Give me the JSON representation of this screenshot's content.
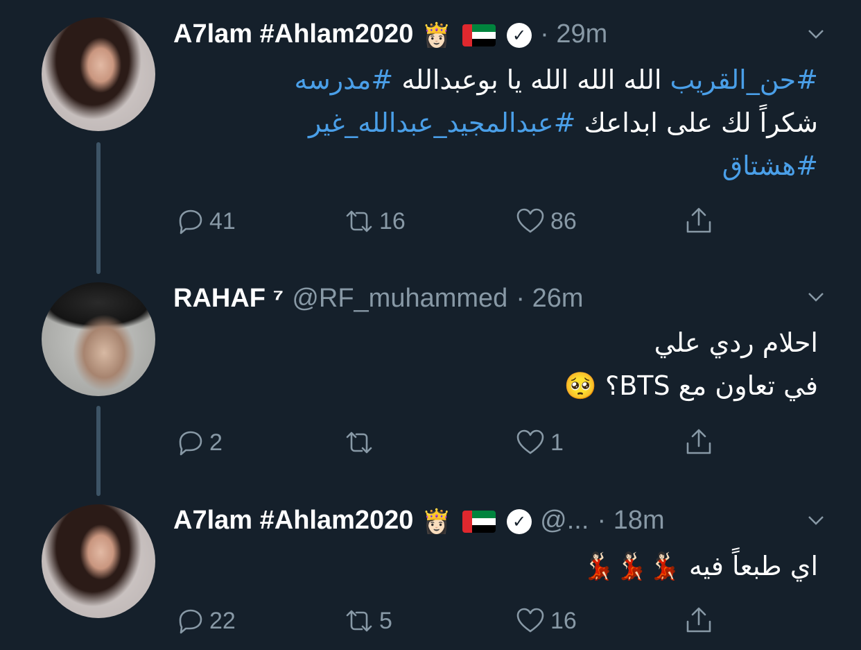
{
  "tweets": [
    {
      "author": "A7lam #Ahlam2020",
      "handle": "",
      "time": "· 29m",
      "lines": [
        [
          {
            "t": "#حن_القريب",
            "h": true
          },
          {
            "t": " الله الله الله يا بوعبدالله ",
            "h": false
          },
          {
            "t": "#مدرسه",
            "h": true
          }
        ],
        [
          {
            "t": "شكراً لك على ابداعك ",
            "h": false
          },
          {
            "t": "#عبدالمجيد_عبدالله_غير",
            "h": true
          }
        ],
        [
          {
            "t": "#هشتاق",
            "h": true
          }
        ]
      ],
      "replies": "41",
      "retweets": "16",
      "likes": "86"
    },
    {
      "author": "RAHAF ⁷",
      "handle": "@RF_muhammed",
      "time": "· 26m",
      "lines": [
        [
          {
            "t": "احلام ردي علي",
            "h": false
          }
        ],
        [
          {
            "t": "في تعاون مع BTS؟ 🥺",
            "h": false
          }
        ]
      ],
      "replies": "2",
      "retweets": "",
      "likes": "1"
    },
    {
      "author": "A7lam #Ahlam2020",
      "handle": "@...",
      "time": "· 18m",
      "lines": [
        [
          {
            "t": "اي طبعاً فيه 💃🏻💃🏻💃🏻",
            "h": false
          }
        ]
      ],
      "replies": "22",
      "retweets": "5",
      "likes": "16"
    }
  ],
  "icons": {
    "crown": "princess-emoji",
    "flag": "uae-flag",
    "verified": "verified-badge"
  },
  "colors": {
    "background": "#15202b",
    "secondary": "#8899a6",
    "link": "#4a9fe8"
  }
}
